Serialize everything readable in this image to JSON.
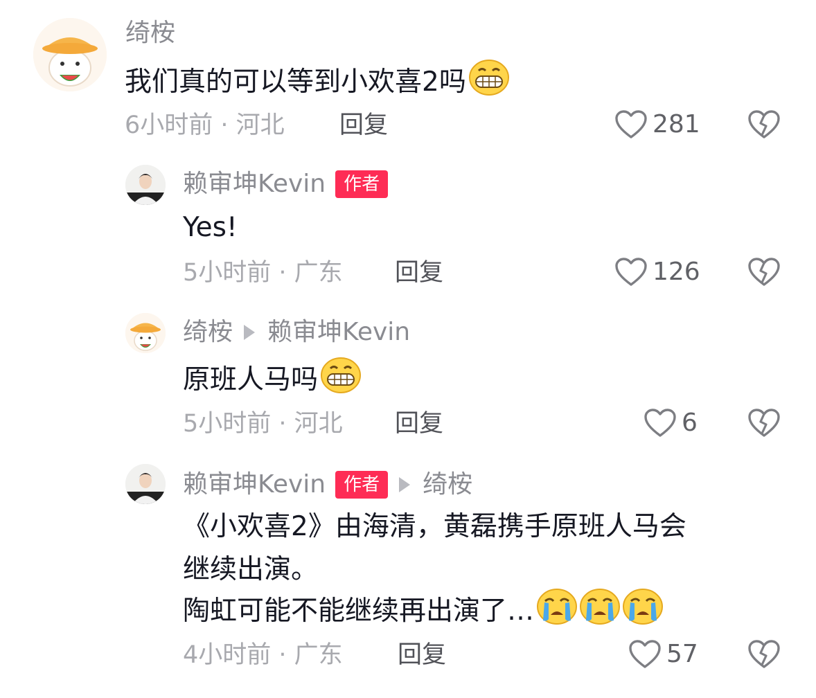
{
  "comments": [
    {
      "username": "绮桉",
      "text": "我们真的可以等到小欢喜2吗",
      "emoji": "grin-emoji",
      "meta": "6小时前 · 河北",
      "reply_label": "回复",
      "likes": "281"
    },
    {
      "username": "赖审坤Kevin",
      "badge": "作者",
      "text": "Yes!",
      "meta": "5小时前 · 广东",
      "reply_label": "回复",
      "likes": "126"
    },
    {
      "username": "绮桉",
      "reply_to": "赖审坤Kevin",
      "text": "原班人马吗",
      "emoji": "grin-emoji",
      "meta": "5小时前 · 河北",
      "reply_label": "回复",
      "likes": "6"
    },
    {
      "username": "赖审坤Kevin",
      "badge": "作者",
      "reply_to": "绮桉",
      "text_lines": [
        "《小欢喜2》由海清，黄磊携手原班人马会",
        "继续出演。",
        "陶虹可能不能继续再出演了…"
      ],
      "emoji": "crying-emoji",
      "meta": "4小时前 · 广东",
      "reply_label": "回复",
      "likes": "57"
    }
  ],
  "colors": {
    "badge": "#fe2c55",
    "username": "#8a8b91",
    "meta": "#a8a9ae",
    "text": "#161823"
  }
}
